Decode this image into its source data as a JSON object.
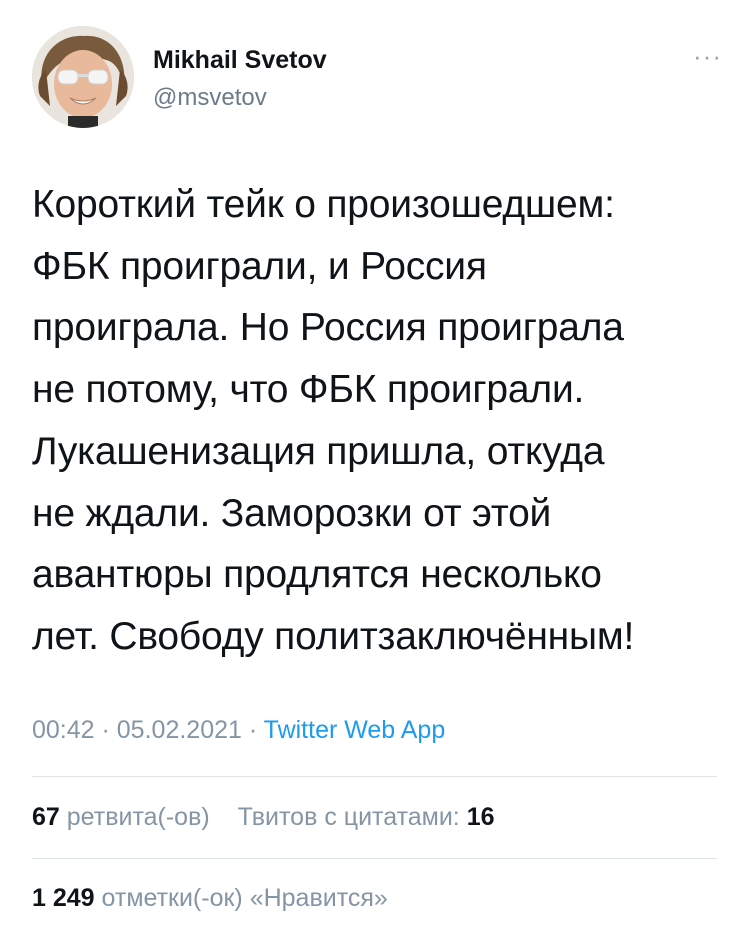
{
  "author": {
    "name": "Mikhail Svetov",
    "handle": "@msvetov"
  },
  "tweet": {
    "lines": [
      "Короткий тейк о произошедшем:",
      "ФБК проиграли, и Россия",
      "проиграла. Но Россия проиграла",
      "не потому, что ФБК проиграли.",
      "Лукашенизация пришла, откуда",
      "не ждали. Заморозки от этой",
      "авантюры продлятся несколько",
      "лет. Свободу политзаключённым!"
    ],
    "time": "00:42",
    "separator1": " · ",
    "date": "05.02.2021",
    "separator2": " · ",
    "source": "Twitter Web App"
  },
  "stats": {
    "retweets_count": "67",
    "retweets_label": "ретвита(-ов)",
    "quotes_label": "Твитов с цитатами:",
    "quotes_count": "16",
    "likes_count": "1 249",
    "likes_label": "отметки(-ок) «Нравится»"
  },
  "icons": {
    "more": "more-options-icon"
  },
  "colors": {
    "link": "#1d9bf0",
    "secondary": "#8595a5",
    "text": "#0f1419"
  }
}
